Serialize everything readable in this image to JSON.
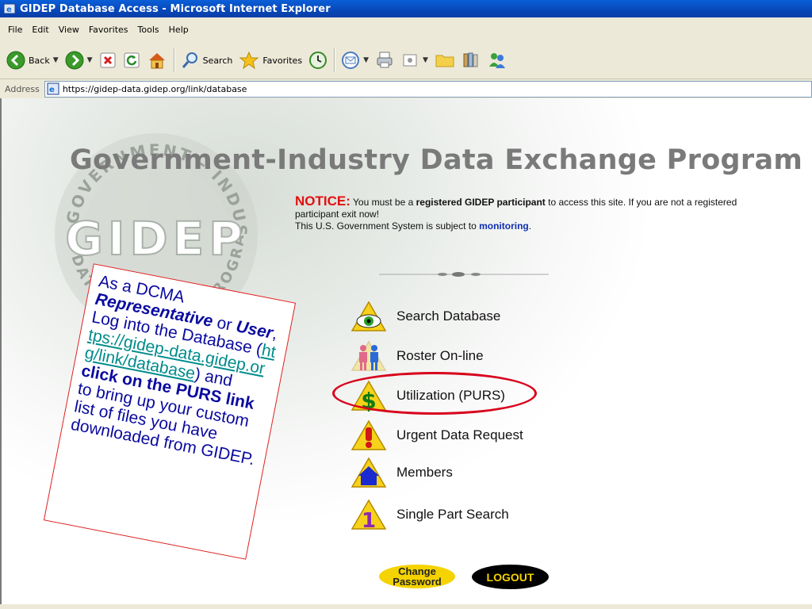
{
  "window": {
    "title": "GIDEP Database Access - Microsoft Internet Explorer"
  },
  "menu": {
    "items": [
      "File",
      "Edit",
      "View",
      "Favorites",
      "Tools",
      "Help"
    ]
  },
  "toolbar": {
    "back_label": "Back",
    "search_label": "Search",
    "favorites_label": "Favorites"
  },
  "address": {
    "label": "Address",
    "url": "https://gidep-data.gidep.org/link/database"
  },
  "page": {
    "title": "Government-Industry Data Exchange Program",
    "seal_text_top": "GOVERNMENT - INDUSTRY",
    "seal_text_bottom": "DATA EXCHANGE PROGRAM",
    "seal_center": "GIDEP",
    "notice": {
      "label": "NOTICE:",
      "part1": " You must be a ",
      "bold1": "registered GIDEP participant",
      "part2": " to access this site. If you are not a registered participant exit now!",
      "line2": "This U.S. Government System is subject to ",
      "monitoring": "monitoring",
      "end": "."
    },
    "links": [
      {
        "label": "Search Database",
        "icon": "eye-icon"
      },
      {
        "label": "Roster On-line",
        "icon": "people-icon"
      },
      {
        "label": "Utilization (PURS)",
        "icon": "dollar-icon"
      },
      {
        "label": "Urgent Data Request",
        "icon": "exclamation-icon"
      },
      {
        "label": "Members",
        "icon": "house-icon"
      },
      {
        "label": "Single Part Search",
        "icon": "number-one-icon"
      }
    ],
    "change_password": "Change Password",
    "logout": "LOGOUT"
  },
  "callout": {
    "t1": "As a DCMA ",
    "t2": "Representative",
    "t3": " or ",
    "t4": "User",
    "t5": ", Log into the Database (",
    "link": "https://gidep-data.gidep.org/link/database",
    "t6": ") and ",
    "t7": "click on the PURS link",
    "t8": " to bring up your custom list of files you have downloaded from GIDEP."
  },
  "colors": {
    "notice_red": "#e01010",
    "highlight_oval": "#d8001c",
    "link_blue": "#1030b0",
    "callout_text": "#0a0aa0",
    "callout_link": "#008c8c",
    "button_yellow": "#f4d300"
  }
}
